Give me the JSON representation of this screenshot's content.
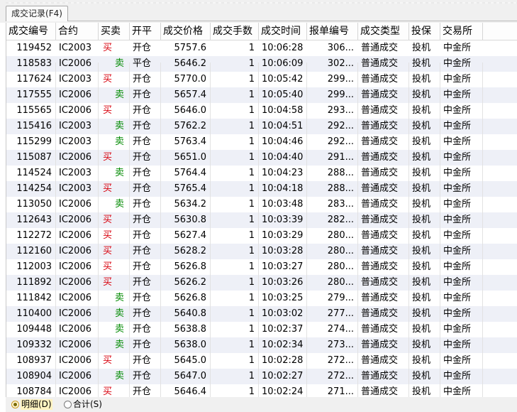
{
  "tab": {
    "label": "成交记录(F4)"
  },
  "columns": [
    "成交编号",
    "合约",
    "买卖",
    "开平",
    "成交价格",
    "成交手数",
    "成交时间",
    "报单编号",
    "成交类型",
    "投保",
    "交易所"
  ],
  "rows": [
    [
      "119452",
      "IC2003",
      "买",
      "开仓",
      "5757.6",
      "1",
      "10:06:28",
      "306...",
      "普通成交",
      "投机",
      "中金所"
    ],
    [
      "118583",
      "IC2006",
      "卖",
      "平仓",
      "5646.2",
      "1",
      "10:06:09",
      "302...",
      "普通成交",
      "投机",
      "中金所"
    ],
    [
      "117624",
      "IC2003",
      "买",
      "开仓",
      "5770.0",
      "1",
      "10:05:42",
      "299...",
      "普通成交",
      "投机",
      "中金所"
    ],
    [
      "117555",
      "IC2006",
      "卖",
      "开仓",
      "5657.4",
      "1",
      "10:05:40",
      "299...",
      "普通成交",
      "投机",
      "中金所"
    ],
    [
      "115565",
      "IC2006",
      "买",
      "开仓",
      "5646.0",
      "1",
      "10:04:58",
      "293...",
      "普通成交",
      "投机",
      "中金所"
    ],
    [
      "115416",
      "IC2003",
      "卖",
      "开仓",
      "5762.2",
      "1",
      "10:04:51",
      "292...",
      "普通成交",
      "投机",
      "中金所"
    ],
    [
      "115299",
      "IC2003",
      "卖",
      "开仓",
      "5763.4",
      "1",
      "10:04:46",
      "292...",
      "普通成交",
      "投机",
      "中金所"
    ],
    [
      "115087",
      "IC2006",
      "买",
      "开仓",
      "5651.0",
      "1",
      "10:04:40",
      "291...",
      "普通成交",
      "投机",
      "中金所"
    ],
    [
      "114524",
      "IC2003",
      "卖",
      "开仓",
      "5764.4",
      "1",
      "10:04:23",
      "288...",
      "普通成交",
      "投机",
      "中金所"
    ],
    [
      "114254",
      "IC2003",
      "买",
      "开仓",
      "5765.4",
      "1",
      "10:04:18",
      "288...",
      "普通成交",
      "投机",
      "中金所"
    ],
    [
      "113050",
      "IC2006",
      "卖",
      "开仓",
      "5634.2",
      "1",
      "10:03:48",
      "283...",
      "普通成交",
      "投机",
      "中金所"
    ],
    [
      "112643",
      "IC2006",
      "买",
      "开仓",
      "5630.8",
      "1",
      "10:03:39",
      "282...",
      "普通成交",
      "投机",
      "中金所"
    ],
    [
      "112272",
      "IC2006",
      "买",
      "开仓",
      "5627.4",
      "1",
      "10:03:29",
      "280...",
      "普通成交",
      "投机",
      "中金所"
    ],
    [
      "112160",
      "IC2006",
      "买",
      "开仓",
      "5628.2",
      "1",
      "10:03:28",
      "280...",
      "普通成交",
      "投机",
      "中金所"
    ],
    [
      "112003",
      "IC2006",
      "买",
      "开仓",
      "5626.8",
      "1",
      "10:03:27",
      "280...",
      "普通成交",
      "投机",
      "中金所"
    ],
    [
      "111892",
      "IC2006",
      "买",
      "开仓",
      "5626.2",
      "1",
      "10:03:26",
      "280...",
      "普通成交",
      "投机",
      "中金所"
    ],
    [
      "111842",
      "IC2006",
      "卖",
      "开仓",
      "5626.8",
      "1",
      "10:03:25",
      "279...",
      "普通成交",
      "投机",
      "中金所"
    ],
    [
      "110400",
      "IC2006",
      "卖",
      "开仓",
      "5640.8",
      "1",
      "10:03:02",
      "277...",
      "普通成交",
      "投机",
      "中金所"
    ],
    [
      "109448",
      "IC2006",
      "卖",
      "开仓",
      "5638.8",
      "1",
      "10:02:37",
      "274...",
      "普通成交",
      "投机",
      "中金所"
    ],
    [
      "109332",
      "IC2006",
      "卖",
      "开仓",
      "5638.0",
      "1",
      "10:02:34",
      "273...",
      "普通成交",
      "投机",
      "中金所"
    ],
    [
      "108937",
      "IC2006",
      "买",
      "开仓",
      "5645.0",
      "1",
      "10:02:28",
      "272...",
      "普通成交",
      "投机",
      "中金所"
    ],
    [
      "108904",
      "IC2006",
      "卖",
      "开仓",
      "5647.0",
      "1",
      "10:02:27",
      "272...",
      "普通成交",
      "投机",
      "中金所"
    ],
    [
      "108784",
      "IC2006",
      "买",
      "开仓",
      "5646.4",
      "1",
      "10:02:24",
      "271...",
      "普通成交",
      "投机",
      "中金所"
    ]
  ],
  "footer": {
    "detail_label": "明细(D)",
    "summary_label": "合计(S)",
    "selected": "detail"
  },
  "colors": {
    "buy": "#d8000c",
    "sell": "#008a00",
    "alt_row": "#eef0f7"
  }
}
